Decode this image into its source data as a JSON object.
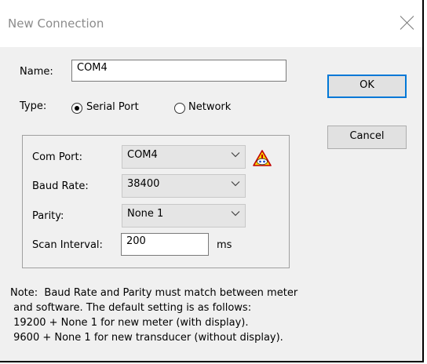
{
  "window": {
    "title": "New Connection"
  },
  "form": {
    "name_label": "Name:",
    "name_value": "COM4",
    "type_label": "Type:",
    "type_options": [
      {
        "label": "Serial Port",
        "checked": true
      },
      {
        "label": "Network",
        "checked": false
      }
    ],
    "com_port_label": "Com Port:",
    "com_port_value": "COM4",
    "baud_rate_label": "Baud Rate:",
    "baud_rate_value": "38400",
    "parity_label": "Parity:",
    "parity_value": "None 1",
    "scan_interval_label": "Scan Interval:",
    "scan_interval_value": "200",
    "scan_interval_unit": "ms"
  },
  "buttons": {
    "ok": "OK",
    "cancel": "Cancel"
  },
  "note": [
    "Note:  Baud Rate and Parity must match between meter",
    " and software. The default setting is as follows:",
    " 19200 + None 1 for new meter (with display).",
    " 9600 + None 1 for new transducer (without display)."
  ],
  "icons": {
    "close": "close-icon",
    "com_port_help": "warning-help-icon",
    "dropdown": "chevron-down-icon"
  },
  "colors": {
    "ok_border": "#0078d7",
    "title_text": "#8c8c8c",
    "dialog_bg": "#f0f0f0"
  }
}
